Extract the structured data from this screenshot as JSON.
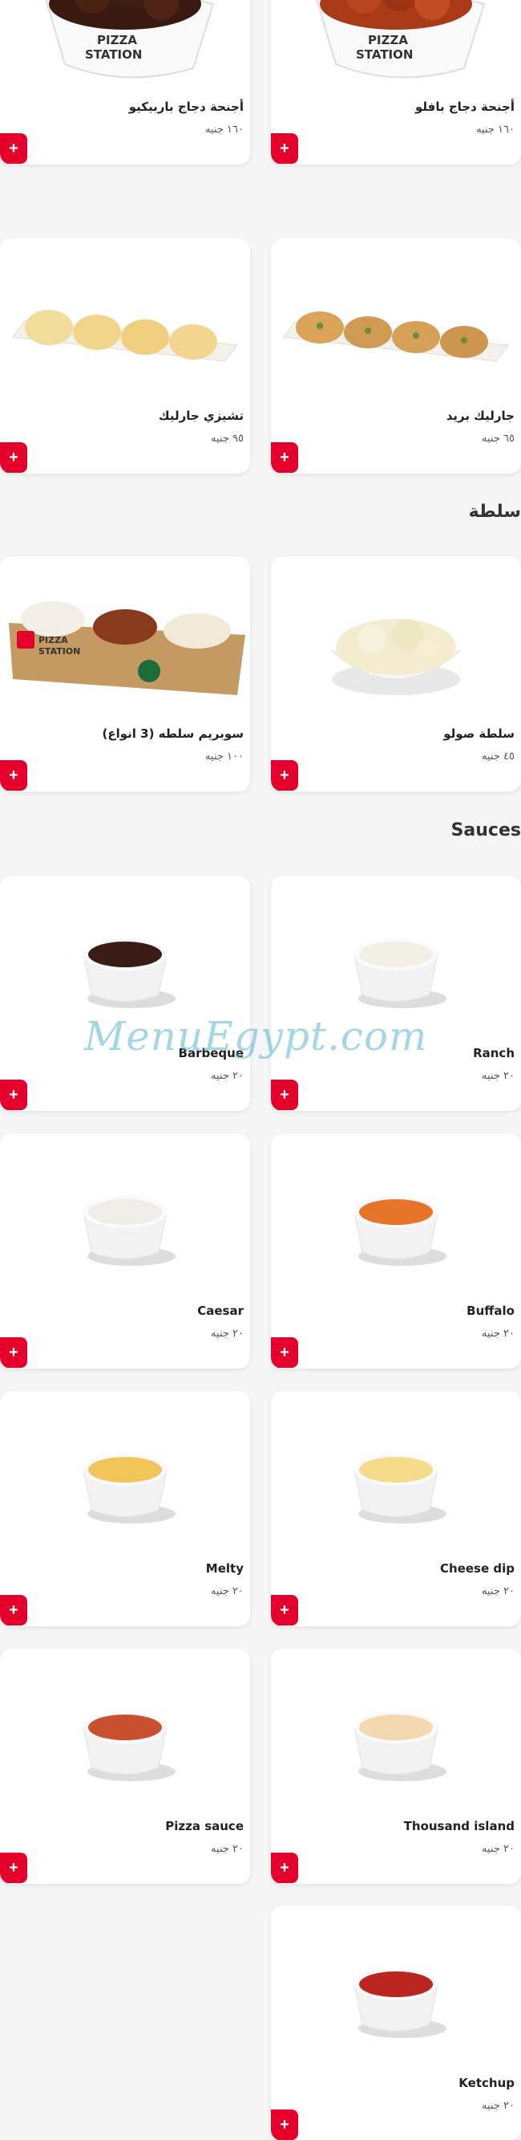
{
  "sections": {
    "salad_title": "سلطة",
    "sauces_title": "Sauces"
  },
  "items": {
    "bbq_wings": {
      "name": "أجنحة دجاج باربيكيو",
      "price": "١٦٠ جنيه"
    },
    "buffalo_wings": {
      "name": "أجنحة دجاج بافلو",
      "price": "١٦٠ جنيه"
    },
    "cheesy_garlic": {
      "name": "تشيزي جارليك",
      "price": "٩٥ جنيه"
    },
    "garlic_bread": {
      "name": "جارليك بريد",
      "price": "٦٥ جنيه"
    },
    "supreme_salad": {
      "name": "سوبريم سلطه (3 انواع)",
      "price": "١٠٠ جنيه"
    },
    "coleslaw": {
      "name": "سلطة صولو",
      "price": "٤٥ جنيه"
    },
    "barbeque": {
      "name": "Barbeque",
      "price": "٢٠ جنيه"
    },
    "ranch": {
      "name": "Ranch",
      "price": "٢٠ جنيه"
    },
    "caesar": {
      "name": "Caesar",
      "price": "٢٠ جنيه"
    },
    "buffalo": {
      "name": "Buffalo",
      "price": "٢٠ جنيه"
    },
    "melty": {
      "name": "Melty",
      "price": "٢٠ جنيه"
    },
    "cheese_dip": {
      "name": "Cheese dip",
      "price": "٢٠ جنيه"
    },
    "pizza_sauce": {
      "name": "Pizza sauce",
      "price": "٢٠ جنيه"
    },
    "thousand_island": {
      "name": "Thousand island",
      "price": "٢٠ جنيه"
    },
    "ketchup": {
      "name": "Ketchup",
      "price": "٢٠ جنيه"
    }
  },
  "ui": {
    "add_symbol": "+",
    "watermark": "MenuEgypt.com"
  },
  "colors": {
    "accent": "#e4002b",
    "background": "#f5f5f5",
    "card": "#ffffff"
  }
}
